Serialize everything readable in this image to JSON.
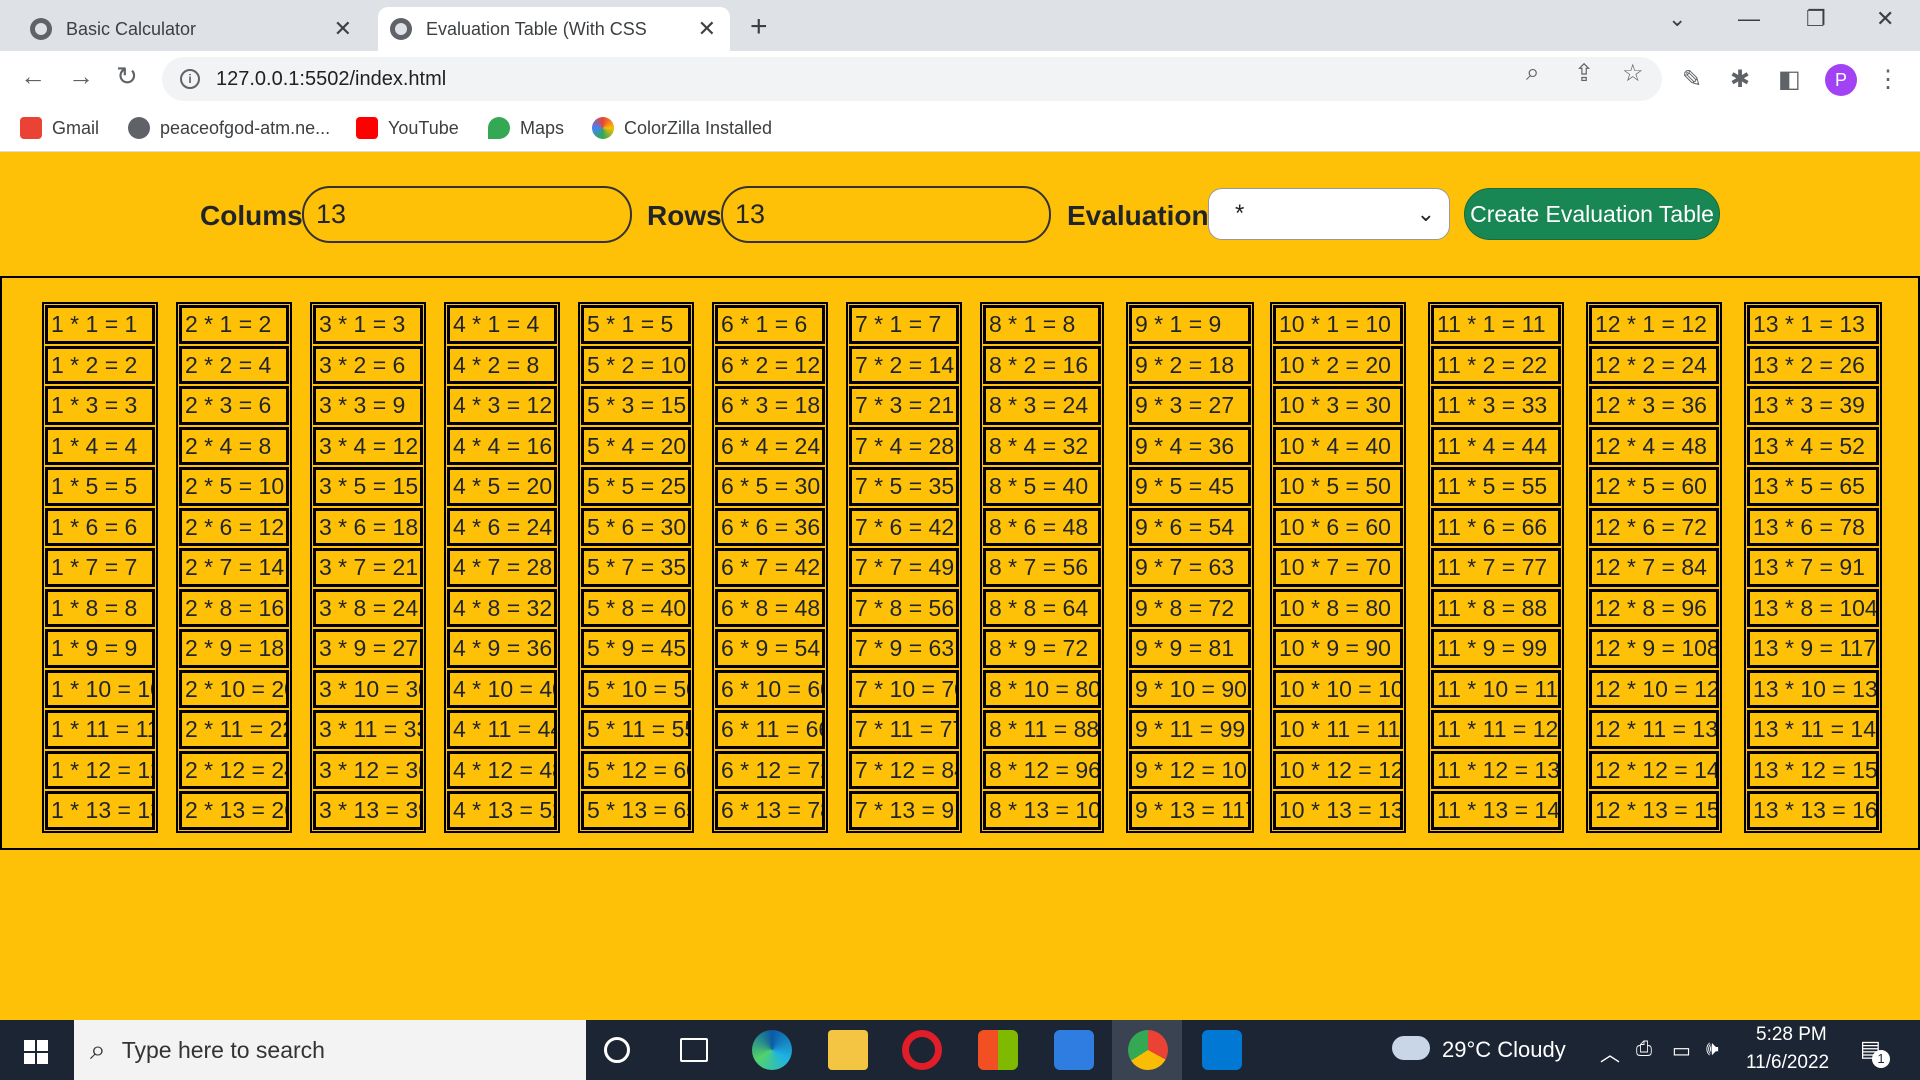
{
  "browser": {
    "tabs": [
      {
        "title": "Basic Calculator",
        "active": false
      },
      {
        "title": "Evaluation Table (With CSS",
        "active": true
      }
    ],
    "new_tab": "+",
    "window_controls": {
      "dropdown": "⌄",
      "minimize": "—",
      "restore": "❐",
      "close": "✕"
    },
    "url": "127.0.0.1:5502/index.html",
    "bookmarks": [
      {
        "label": "Gmail",
        "icon": "gmail-icon",
        "color": "#ea4335"
      },
      {
        "label": "peaceofgod-atm.ne...",
        "icon": "globe-icon",
        "color": "#5f6368"
      },
      {
        "label": "YouTube",
        "icon": "youtube-icon",
        "color": "#ff0000"
      },
      {
        "label": "Maps",
        "icon": "maps-icon",
        "color": "#34a853"
      },
      {
        "label": "ColorZilla Installed",
        "icon": "colorzilla-icon",
        "color": "#4285f4"
      }
    ],
    "profile_initial": "P"
  },
  "controls": {
    "columns_label": "Colums",
    "columns_value": "13",
    "rows_label": "Rows",
    "rows_value": "13",
    "evaluation_label": "Evaluation",
    "evaluation_selected": "*",
    "create_button": "Create Evaluation Table"
  },
  "table": {
    "operator": "*",
    "columns": 13,
    "rows": 13
  },
  "taskbar": {
    "search_placeholder": "Type here to search",
    "weather": "29°C  Cloudy",
    "time": "5:28 PM",
    "date": "11/6/2022",
    "notification_count": "1",
    "apps": [
      "cortana-icon",
      "task-view-icon",
      "edge-icon",
      "file-explorer-icon",
      "opera-icon",
      "store-icon",
      "mail-icon",
      "chrome-icon",
      "vscode-icon"
    ]
  },
  "colors": {
    "page_background": "#ffc107",
    "button_green": "#198754"
  }
}
